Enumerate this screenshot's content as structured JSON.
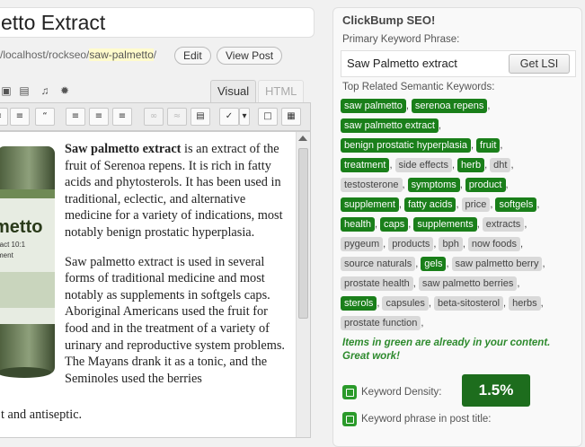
{
  "post": {
    "title": "etto Extract",
    "permalink_base": "/localhost/rockseo/",
    "permalink_slug": "saw-palmetto",
    "permalink_end": "/",
    "edit_label": "Edit",
    "view_post_label": "View Post"
  },
  "editor": {
    "tabs": [
      {
        "label": "Visual",
        "active": true
      },
      {
        "label": "HTML",
        "active": false
      }
    ],
    "media_icons": [
      "image-icon",
      "video-icon",
      "audio-icon",
      "media-icon"
    ],
    "toolbar_icons": [
      "bullet-list-icon",
      "numbered-list-icon",
      "blockquote-icon",
      "align-left-icon",
      "align-center-icon",
      "align-right-icon",
      "link-icon",
      "unlink-icon",
      "insert-more-icon",
      "spellcheck-icon",
      "dropdown-icon",
      "fullscreen-icon",
      "kitchen-sink-icon"
    ],
    "paragraph1_bold": "Saw palmetto extract",
    "paragraph1_rest": " is an extract of the fruit of Serenoa repens. It is rich in fatty acids and phytosterols. It has been used in traditional, eclectic, and alternative medicine for a variety of indications, most notably benign prostatic hyperplasia.",
    "paragraph2": "Saw palmetto extract is used in several forms of traditional medicine and most notably as supplements in softgels caps. Aboriginal Americans used the fruit for food and in the treatment of a variety of urinary and reproductive system problems. The Mayans drank it as a tonic, and the Seminoles used the berries",
    "last_line": "t and antiseptic.",
    "bottle_label_line1": "metto",
    "bottle_label_line2": "ract 10:1",
    "bottle_label_line3": "ment"
  },
  "seo": {
    "title": "ClickBump SEO!",
    "primary_label": "Primary Keyword Phrase:",
    "primary_value": "Saw Palmetto extract",
    "get_lsi_label": "Get LSI",
    "related_label": "Top Related Semantic Keywords:",
    "keyword_rows": [
      [
        {
          "t": "saw palmetto",
          "g": true
        },
        {
          "t": "serenoa repens",
          "g": true
        }
      ],
      [
        {
          "t": "saw palmetto extract",
          "g": true
        }
      ],
      [
        {
          "t": "benign prostatic hyperplasia",
          "g": true
        },
        {
          "t": "fruit",
          "g": true
        }
      ],
      [
        {
          "t": "treatment",
          "g": true
        },
        {
          "t": "side effects",
          "g": false
        },
        {
          "t": "herb",
          "g": true
        },
        {
          "t": "dht",
          "g": false
        }
      ],
      [
        {
          "t": "testosterone",
          "g": false
        },
        {
          "t": "symptoms",
          "g": true
        },
        {
          "t": "product",
          "g": true
        }
      ],
      [
        {
          "t": "supplement",
          "g": true
        },
        {
          "t": "fatty acids",
          "g": true
        },
        {
          "t": "price",
          "g": false
        },
        {
          "t": "softgels",
          "g": true
        }
      ],
      [
        {
          "t": "health",
          "g": true
        },
        {
          "t": "caps",
          "g": true
        },
        {
          "t": "supplements",
          "g": true
        },
        {
          "t": "extracts",
          "g": false
        }
      ],
      [
        {
          "t": "pygeum",
          "g": false
        },
        {
          "t": "products",
          "g": false
        },
        {
          "t": "bph",
          "g": false
        },
        {
          "t": "now foods",
          "g": false
        }
      ],
      [
        {
          "t": "source naturals",
          "g": false
        },
        {
          "t": "gels",
          "g": true
        },
        {
          "t": "saw palmetto berry",
          "g": false
        }
      ],
      [
        {
          "t": "prostate health",
          "g": false
        },
        {
          "t": "saw palmetto berries",
          "g": false
        }
      ],
      [
        {
          "t": "sterols",
          "g": true
        },
        {
          "t": "capsules",
          "g": false
        },
        {
          "t": "beta-sitosterol",
          "g": false
        },
        {
          "t": "herbs",
          "g": false
        }
      ],
      [
        {
          "t": "prostate function",
          "g": false
        }
      ]
    ],
    "note": "Items in green are already in your content. Great work!",
    "density_label": "Keyword Density:",
    "density_value": "1.5%",
    "in_title_label": "Keyword phrase in post title:"
  },
  "colors": {
    "keyword_green": "#1a7f1a",
    "keyword_gray": "#d9d9d9",
    "note_green": "#2d8a2d",
    "density_bg": "#1d6d1d"
  }
}
